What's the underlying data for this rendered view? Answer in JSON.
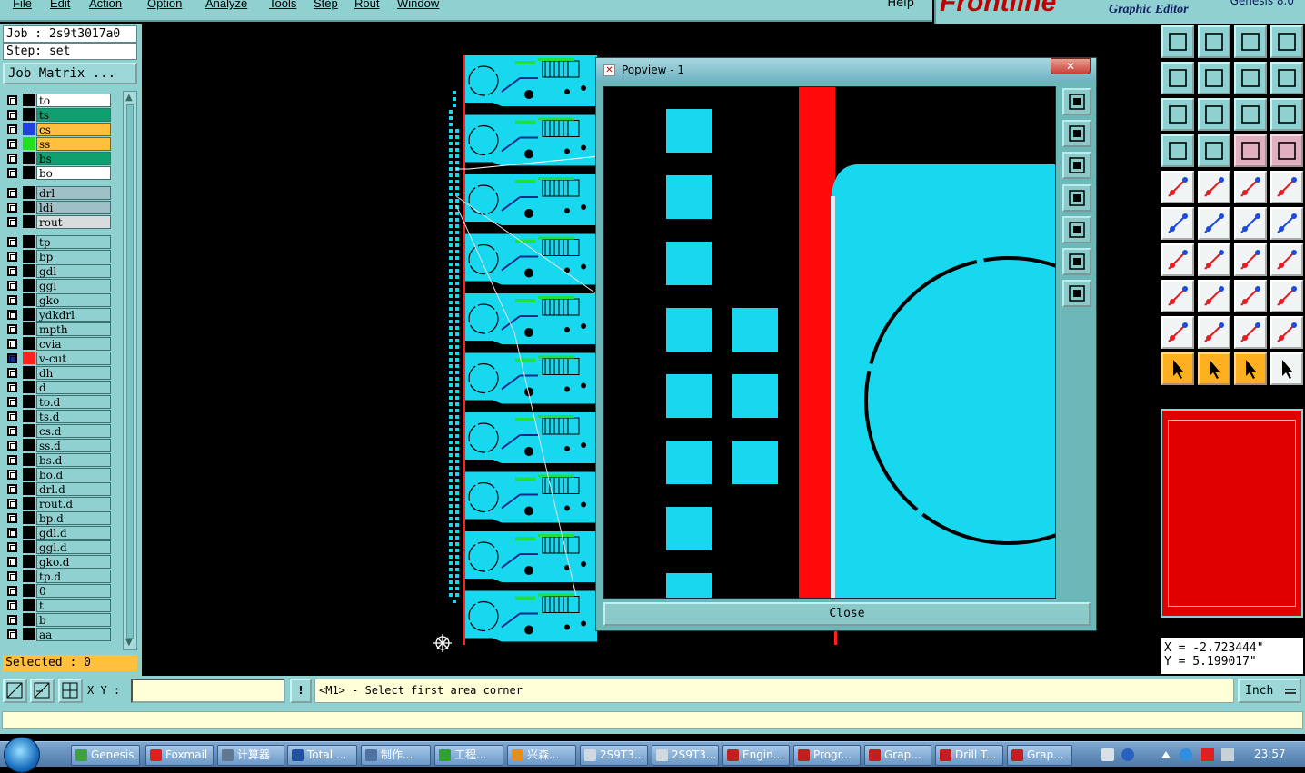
{
  "menu": {
    "items": [
      "File",
      "Edit",
      "Action",
      "Option",
      "Analyze",
      "Tools",
      "Step",
      "Rout",
      "Window"
    ],
    "help": "Help"
  },
  "brand": {
    "logo": "Frontline",
    "subtitle": "Graphic Editor",
    "version": "Genesis 8.0"
  },
  "job": {
    "job_label": "Job : 2s9t3017a0",
    "step_label": "Step: set",
    "matrix_button": "Job Matrix ..."
  },
  "layers": [
    {
      "name": "to",
      "color": "#ffffff",
      "swatch": "#000000"
    },
    {
      "name": "ts",
      "color": "#10a070",
      "swatch": "#000000"
    },
    {
      "name": "cs",
      "color": "#ffc040",
      "swatch": "#2040e0"
    },
    {
      "name": "ss",
      "color": "#ffc040",
      "swatch": "#20e020"
    },
    {
      "name": "bs",
      "color": "#10a070",
      "swatch": "#000000"
    },
    {
      "name": "bo",
      "color": "#ffffff",
      "swatch": "#000000"
    },
    {
      "name": "drl",
      "color": "#a0c0c8",
      "swatch": "#000000"
    },
    {
      "name": "ldi",
      "color": "#a0c0c8",
      "swatch": "#000000"
    },
    {
      "name": "rout",
      "color": "#d8dcdc",
      "swatch": "#000000"
    },
    {
      "name": "tp",
      "color": "#8fd0d0",
      "swatch": "#000000"
    },
    {
      "name": "bp",
      "color": "#8fd0d0",
      "swatch": "#000000"
    },
    {
      "name": "gdl",
      "color": "#8fd0d0",
      "swatch": "#000000"
    },
    {
      "name": "ggl",
      "color": "#8fd0d0",
      "swatch": "#000000"
    },
    {
      "name": "gko",
      "color": "#8fd0d0",
      "swatch": "#000000"
    },
    {
      "name": "ydkdrl",
      "color": "#8fd0d0",
      "swatch": "#000000"
    },
    {
      "name": "mpth",
      "color": "#8fd0d0",
      "swatch": "#000000"
    },
    {
      "name": "cvia",
      "color": "#8fd0d0",
      "swatch": "#000000"
    },
    {
      "name": "v-cut",
      "color": "#8fd0d0",
      "swatch": "#ff2020",
      "active": true
    },
    {
      "name": "dh",
      "color": "#8fd0d0",
      "swatch": "#000000"
    },
    {
      "name": "d",
      "color": "#8fd0d0",
      "swatch": "#000000"
    },
    {
      "name": "to.d",
      "color": "#8fd0d0",
      "swatch": "#000000"
    },
    {
      "name": "ts.d",
      "color": "#8fd0d0",
      "swatch": "#000000"
    },
    {
      "name": "cs.d",
      "color": "#8fd0d0",
      "swatch": "#000000"
    },
    {
      "name": "ss.d",
      "color": "#8fd0d0",
      "swatch": "#000000"
    },
    {
      "name": "bs.d",
      "color": "#8fd0d0",
      "swatch": "#000000"
    },
    {
      "name": "bo.d",
      "color": "#8fd0d0",
      "swatch": "#000000"
    },
    {
      "name": "drl.d",
      "color": "#8fd0d0",
      "swatch": "#000000"
    },
    {
      "name": "rout.d",
      "color": "#8fd0d0",
      "swatch": "#000000"
    },
    {
      "name": "bp.d",
      "color": "#8fd0d0",
      "swatch": "#000000"
    },
    {
      "name": "gdl.d",
      "color": "#8fd0d0",
      "swatch": "#000000"
    },
    {
      "name": "ggl.d",
      "color": "#8fd0d0",
      "swatch": "#000000"
    },
    {
      "name": "gko.d",
      "color": "#8fd0d0",
      "swatch": "#000000"
    },
    {
      "name": "tp.d",
      "color": "#8fd0d0",
      "swatch": "#000000"
    },
    {
      "name": "0",
      "color": "#8fd0d0",
      "swatch": "#000000"
    },
    {
      "name": "t",
      "color": "#8fd0d0",
      "swatch": "#000000"
    },
    {
      "name": "b",
      "color": "#8fd0d0",
      "swatch": "#000000"
    },
    {
      "name": "aa",
      "color": "#8fd0d0",
      "swatch": "#000000"
    }
  ],
  "selected": "Selected : 0",
  "popview": {
    "title": "Popview - 1",
    "close_x": "✕",
    "close_label": "Close",
    "tools": [
      "zoom-window-icon",
      "zoom-home-icon",
      "zoom-in-icon",
      "pan-left-icon",
      "pan-right-icon",
      "zoom-fit-icon",
      "zoom-reset-icon"
    ]
  },
  "coords": {
    "x": "X = -2.723444\"",
    "y": "Y = 5.199017\""
  },
  "command": {
    "xy_label": "X Y :",
    "xy_value": "",
    "prompt": "<M1> - Select first area corner",
    "unit": "Inch"
  },
  "taskbar": {
    "tasks": [
      {
        "label": "Genesis",
        "icon": "#40a040"
      },
      {
        "label": "Foxmail",
        "icon": "#e02020"
      },
      {
        "label": "计算器",
        "icon": "#607890"
      },
      {
        "label": "Total ...",
        "icon": "#2050a0"
      },
      {
        "label": "制作...",
        "icon": "#5070a0"
      },
      {
        "label": "工程...",
        "icon": "#30a030"
      },
      {
        "label": "兴森...",
        "icon": "#e09020"
      },
      {
        "label": "2S9T3...",
        "icon": "#d0d8e0"
      },
      {
        "label": "2S9T3...",
        "icon": "#d0d8e0"
      },
      {
        "label": "Engin...",
        "icon": "#c02020"
      },
      {
        "label": "Progr...",
        "icon": "#c02020"
      },
      {
        "label": "Grap...",
        "icon": "#c02020"
      },
      {
        "label": "Drill T...",
        "icon": "#c02020"
      },
      {
        "label": "Grap...",
        "icon": "#c02020"
      }
    ],
    "clock": "23:57"
  }
}
